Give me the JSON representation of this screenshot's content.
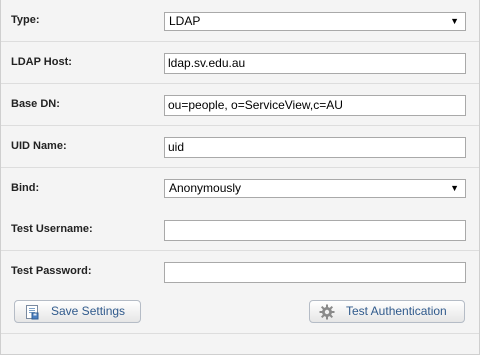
{
  "form": {
    "type": {
      "label": "Type:",
      "value": "LDAP"
    },
    "ldap_host": {
      "label": "LDAP Host:",
      "value": "ldap.sv.edu.au"
    },
    "base_dn": {
      "label": "Base DN:",
      "value": "ou=people, o=ServiceView,c=AU"
    },
    "uid_name": {
      "label": "UID Name:",
      "value": "uid"
    },
    "bind": {
      "label": "Bind:",
      "value": "Anonymously"
    },
    "test_username": {
      "label": "Test Username:",
      "value": ""
    },
    "test_password": {
      "label": "Test Password:",
      "value": ""
    }
  },
  "buttons": {
    "save": {
      "label": "Save Settings",
      "icon": "save-settings-icon"
    },
    "test": {
      "label": "Test Authentication",
      "icon": "gear-icon"
    }
  },
  "colors": {
    "background": "#f4f4f4",
    "button_text": "#305a8c",
    "border": "#a9a9a9"
  }
}
